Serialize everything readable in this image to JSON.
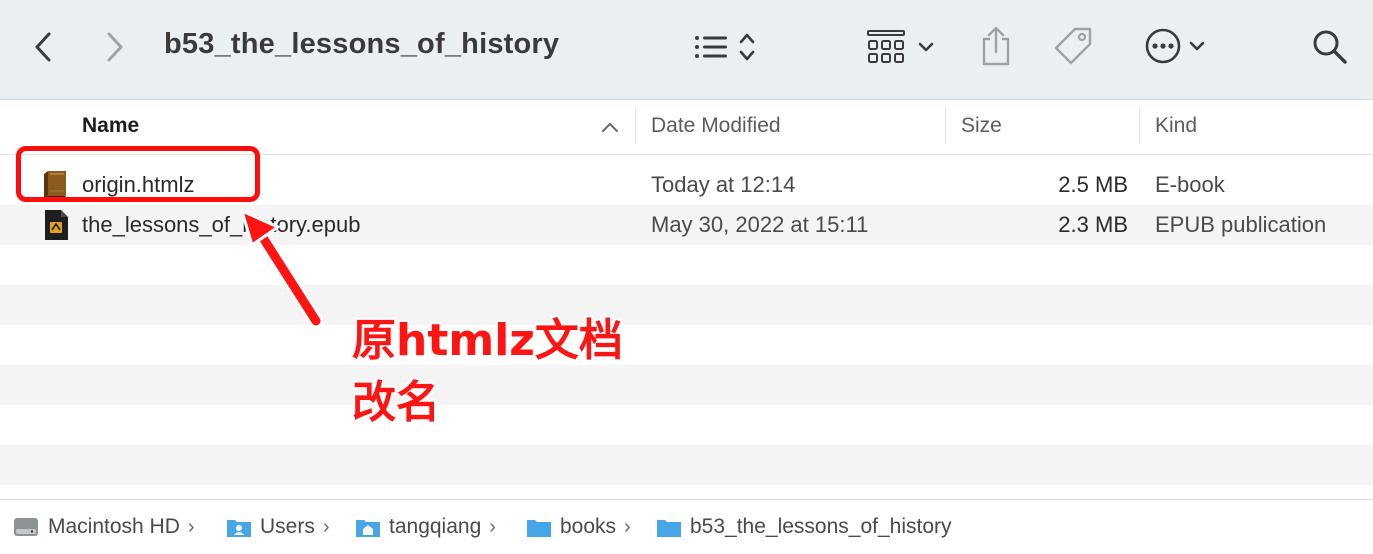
{
  "toolbar": {
    "title": "b53_the_lessons_of_history",
    "icons": [
      "back-chevron",
      "forward-chevron",
      "list-view",
      "sort-arrows",
      "grid-view",
      "dropdown-chevron",
      "share",
      "tag",
      "more-ellipsis",
      "dropdown-chevron",
      "search"
    ]
  },
  "columns": {
    "name": "Name",
    "date_modified": "Date Modified",
    "size": "Size",
    "kind": "Kind"
  },
  "files": [
    {
      "name": "origin.htmlz",
      "date": "Today at 12:14",
      "size": "2.5 MB",
      "kind": "E-book",
      "icon": "ebook-icon"
    },
    {
      "name": "the_lessons_of_history.epub",
      "date": "May 30, 2022 at 15:11",
      "size": "2.3 MB",
      "kind": "EPUB publication",
      "icon": "epub-icon"
    }
  ],
  "annotation": {
    "line1": "原htmlz文档",
    "line2": "改名",
    "color": "#ff1414"
  },
  "pathbar": {
    "items": [
      {
        "label": "Macintosh HD",
        "icon": "hard-drive-icon"
      },
      {
        "label": "Users",
        "icon": "users-folder-icon"
      },
      {
        "label": "tangqiang",
        "icon": "home-folder-icon"
      },
      {
        "label": "books",
        "icon": "folder-icon"
      },
      {
        "label": "b53_the_lessons_of_history",
        "icon": "folder-icon"
      }
    ]
  }
}
